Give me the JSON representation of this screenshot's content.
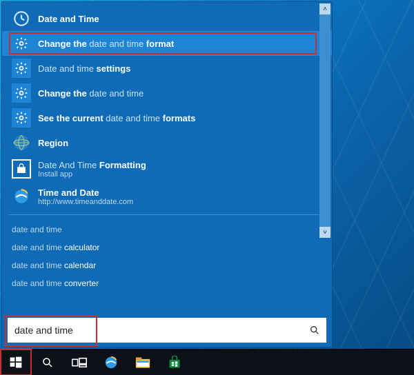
{
  "results": [
    {
      "icon": "clock",
      "parts": [
        {
          "t": "Date and Time",
          "w": "bold"
        }
      ]
    },
    {
      "icon": "gear",
      "selected": true,
      "parts": [
        {
          "t": "Change the ",
          "w": "bold"
        },
        {
          "t": "date and time ",
          "w": "dim"
        },
        {
          "t": "format",
          "w": "bold"
        }
      ]
    },
    {
      "icon": "gear",
      "parts": [
        {
          "t": "Date and time ",
          "w": "dim"
        },
        {
          "t": "settings",
          "w": "bold"
        }
      ]
    },
    {
      "icon": "gear",
      "parts": [
        {
          "t": "Change the ",
          "w": "bold"
        },
        {
          "t": "date and time",
          "w": "dim"
        }
      ]
    },
    {
      "icon": "gear",
      "parts": [
        {
          "t": "See the current ",
          "w": "bold"
        },
        {
          "t": "date and time ",
          "w": "dim"
        },
        {
          "t": "formats",
          "w": "bold"
        }
      ]
    },
    {
      "icon": "globe",
      "parts": [
        {
          "t": "Region",
          "w": "bold"
        }
      ]
    },
    {
      "icon": "store",
      "parts": [
        {
          "t": "Date And Time ",
          "w": "dim"
        },
        {
          "t": "Formatting",
          "w": "bold"
        }
      ],
      "sub": "Install app"
    },
    {
      "icon": "ie",
      "parts": [
        {
          "t": "Time and Date",
          "w": "bold"
        }
      ],
      "sub": "http://www.timeanddate.com"
    }
  ],
  "suggestions": [
    [
      {
        "t": "date and time",
        "w": "dim"
      }
    ],
    [
      {
        "t": "date and time",
        "w": "dim"
      },
      {
        "t": " calculator",
        "w": "hl"
      }
    ],
    [
      {
        "t": "date and time",
        "w": "dim"
      },
      {
        "t": " calendar",
        "w": "hl"
      }
    ],
    [
      {
        "t": "date and time",
        "w": "dim"
      },
      {
        "t": " converter",
        "w": "hl"
      }
    ]
  ],
  "search": {
    "value": "date and time"
  },
  "scroll": {
    "up": "˄",
    "down": "˅"
  },
  "icons": {
    "clock": "clock-icon",
    "gear": "gear-icon",
    "globe": "globe-icon",
    "store": "store-icon",
    "ie": "ie-icon",
    "search": "search-icon",
    "start": "start-icon",
    "taskview": "taskview-icon",
    "explorer": "explorer-icon"
  }
}
